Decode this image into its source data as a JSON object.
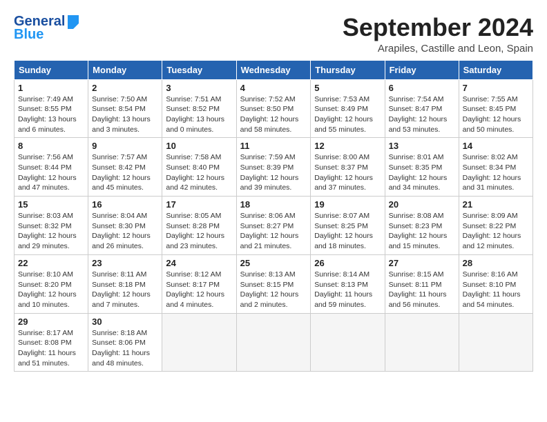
{
  "header": {
    "logo_general": "General",
    "logo_blue": "Blue",
    "month_title": "September 2024",
    "subtitle": "Arapiles, Castille and Leon, Spain"
  },
  "calendar": {
    "days_of_week": [
      "Sunday",
      "Monday",
      "Tuesday",
      "Wednesday",
      "Thursday",
      "Friday",
      "Saturday"
    ],
    "weeks": [
      [
        {
          "day": "1",
          "info": "Sunrise: 7:49 AM\nSunset: 8:55 PM\nDaylight: 13 hours\nand 6 minutes."
        },
        {
          "day": "2",
          "info": "Sunrise: 7:50 AM\nSunset: 8:54 PM\nDaylight: 13 hours\nand 3 minutes."
        },
        {
          "day": "3",
          "info": "Sunrise: 7:51 AM\nSunset: 8:52 PM\nDaylight: 13 hours\nand 0 minutes."
        },
        {
          "day": "4",
          "info": "Sunrise: 7:52 AM\nSunset: 8:50 PM\nDaylight: 12 hours\nand 58 minutes."
        },
        {
          "day": "5",
          "info": "Sunrise: 7:53 AM\nSunset: 8:49 PM\nDaylight: 12 hours\nand 55 minutes."
        },
        {
          "day": "6",
          "info": "Sunrise: 7:54 AM\nSunset: 8:47 PM\nDaylight: 12 hours\nand 53 minutes."
        },
        {
          "day": "7",
          "info": "Sunrise: 7:55 AM\nSunset: 8:45 PM\nDaylight: 12 hours\nand 50 minutes."
        }
      ],
      [
        {
          "day": "8",
          "info": "Sunrise: 7:56 AM\nSunset: 8:44 PM\nDaylight: 12 hours\nand 47 minutes."
        },
        {
          "day": "9",
          "info": "Sunrise: 7:57 AM\nSunset: 8:42 PM\nDaylight: 12 hours\nand 45 minutes."
        },
        {
          "day": "10",
          "info": "Sunrise: 7:58 AM\nSunset: 8:40 PM\nDaylight: 12 hours\nand 42 minutes."
        },
        {
          "day": "11",
          "info": "Sunrise: 7:59 AM\nSunset: 8:39 PM\nDaylight: 12 hours\nand 39 minutes."
        },
        {
          "day": "12",
          "info": "Sunrise: 8:00 AM\nSunset: 8:37 PM\nDaylight: 12 hours\nand 37 minutes."
        },
        {
          "day": "13",
          "info": "Sunrise: 8:01 AM\nSunset: 8:35 PM\nDaylight: 12 hours\nand 34 minutes."
        },
        {
          "day": "14",
          "info": "Sunrise: 8:02 AM\nSunset: 8:34 PM\nDaylight: 12 hours\nand 31 minutes."
        }
      ],
      [
        {
          "day": "15",
          "info": "Sunrise: 8:03 AM\nSunset: 8:32 PM\nDaylight: 12 hours\nand 29 minutes."
        },
        {
          "day": "16",
          "info": "Sunrise: 8:04 AM\nSunset: 8:30 PM\nDaylight: 12 hours\nand 26 minutes."
        },
        {
          "day": "17",
          "info": "Sunrise: 8:05 AM\nSunset: 8:28 PM\nDaylight: 12 hours\nand 23 minutes."
        },
        {
          "day": "18",
          "info": "Sunrise: 8:06 AM\nSunset: 8:27 PM\nDaylight: 12 hours\nand 21 minutes."
        },
        {
          "day": "19",
          "info": "Sunrise: 8:07 AM\nSunset: 8:25 PM\nDaylight: 12 hours\nand 18 minutes."
        },
        {
          "day": "20",
          "info": "Sunrise: 8:08 AM\nSunset: 8:23 PM\nDaylight: 12 hours\nand 15 minutes."
        },
        {
          "day": "21",
          "info": "Sunrise: 8:09 AM\nSunset: 8:22 PM\nDaylight: 12 hours\nand 12 minutes."
        }
      ],
      [
        {
          "day": "22",
          "info": "Sunrise: 8:10 AM\nSunset: 8:20 PM\nDaylight: 12 hours\nand 10 minutes."
        },
        {
          "day": "23",
          "info": "Sunrise: 8:11 AM\nSunset: 8:18 PM\nDaylight: 12 hours\nand 7 minutes."
        },
        {
          "day": "24",
          "info": "Sunrise: 8:12 AM\nSunset: 8:17 PM\nDaylight: 12 hours\nand 4 minutes."
        },
        {
          "day": "25",
          "info": "Sunrise: 8:13 AM\nSunset: 8:15 PM\nDaylight: 12 hours\nand 2 minutes."
        },
        {
          "day": "26",
          "info": "Sunrise: 8:14 AM\nSunset: 8:13 PM\nDaylight: 11 hours\nand 59 minutes."
        },
        {
          "day": "27",
          "info": "Sunrise: 8:15 AM\nSunset: 8:11 PM\nDaylight: 11 hours\nand 56 minutes."
        },
        {
          "day": "28",
          "info": "Sunrise: 8:16 AM\nSunset: 8:10 PM\nDaylight: 11 hours\nand 54 minutes."
        }
      ],
      [
        {
          "day": "29",
          "info": "Sunrise: 8:17 AM\nSunset: 8:08 PM\nDaylight: 11 hours\nand 51 minutes."
        },
        {
          "day": "30",
          "info": "Sunrise: 8:18 AM\nSunset: 8:06 PM\nDaylight: 11 hours\nand 48 minutes."
        },
        {
          "day": "",
          "info": ""
        },
        {
          "day": "",
          "info": ""
        },
        {
          "day": "",
          "info": ""
        },
        {
          "day": "",
          "info": ""
        },
        {
          "day": "",
          "info": ""
        }
      ]
    ]
  }
}
